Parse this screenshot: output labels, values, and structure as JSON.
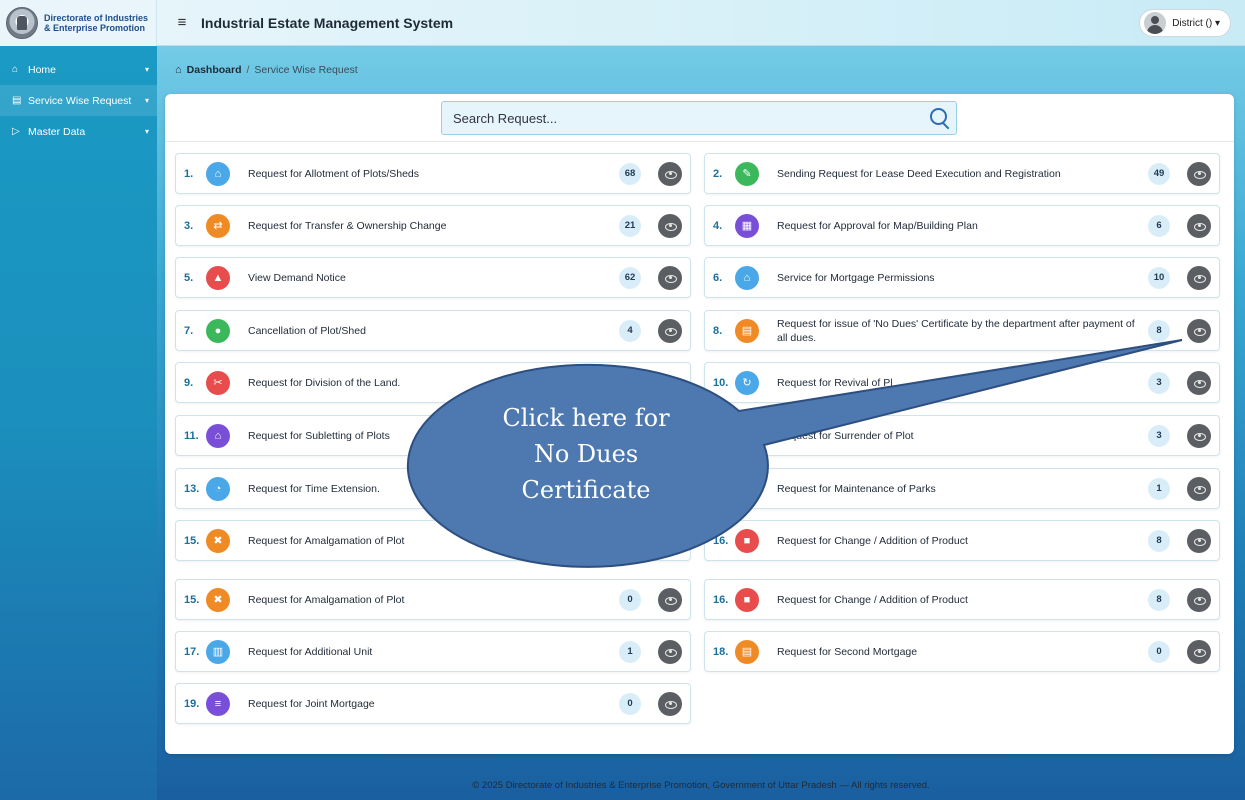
{
  "brand": {
    "line1": "Directorate of Industries",
    "line2": "& Enterprise Promotion"
  },
  "header": {
    "title": "Industrial Estate Management System",
    "user_label": "District () ▾"
  },
  "sidebar": {
    "items": [
      {
        "label": "Home",
        "icon": "home-icon"
      },
      {
        "label": "Service Wise Request",
        "icon": "document-icon"
      },
      {
        "label": "Master Data",
        "icon": "file-icon"
      }
    ]
  },
  "breadcrumb": {
    "root": "Dashboard",
    "separator": "/",
    "current": "Service Wise Request"
  },
  "search": {
    "placeholder": "Search Request..."
  },
  "services": [
    {
      "n": "1.",
      "label": "Request for Allotment of Plots/Sheds",
      "count": "68",
      "color": "#4aa8e8",
      "icon": "bank-icon",
      "glyph": "⌂"
    },
    {
      "n": "2.",
      "label": "Sending Request for Lease Deed Execution and Registration",
      "count": "49",
      "color": "#3cb85c",
      "icon": "edit-icon",
      "glyph": "✎"
    },
    {
      "n": "3.",
      "label": "Request for Transfer & Ownership Change",
      "count": "21",
      "color": "#f08a24",
      "icon": "transfer-icon",
      "glyph": "⇄"
    },
    {
      "n": "4.",
      "label": "Request for Approval for Map/Building Plan",
      "count": "6",
      "color": "#7a4fd8",
      "icon": "map-icon",
      "glyph": "▦"
    },
    {
      "n": "5.",
      "label": "View Demand Notice",
      "count": "62",
      "color": "#e84c4c",
      "icon": "bell-icon",
      "glyph": "▲"
    },
    {
      "n": "6.",
      "label": "Service for Mortgage Permissions",
      "count": "10",
      "color": "#4aa8e8",
      "icon": "bank-icon",
      "glyph": "⌂"
    },
    {
      "n": "7.",
      "label": "Cancellation of Plot/Shed",
      "count": "4",
      "color": "#3cb85c",
      "icon": "cancel-icon",
      "glyph": "●"
    },
    {
      "n": "8.",
      "label": "Request for issue of 'No Dues' Certificate by the department after payment of all dues.",
      "count": "8",
      "color": "#f08a24",
      "icon": "certificate-icon",
      "glyph": "▤"
    },
    {
      "n": "9.",
      "label": "Request for Division of the Land.",
      "count": "",
      "color": "#e84c4c",
      "icon": "scissors-icon",
      "glyph": "✂"
    },
    {
      "n": "10.",
      "label": "Request for Revival of Pl",
      "count": "3",
      "color": "#4aa8e8",
      "icon": "refresh-icon",
      "glyph": "↻"
    },
    {
      "n": "11.",
      "label": "Request for Subletting of Plots",
      "count": "",
      "color": "#7a4fd8",
      "icon": "home-icon",
      "glyph": "⌂"
    },
    {
      "n": "12.",
      "label": "Request for Surrender of Plot",
      "count": "3",
      "color": "#3cb85c",
      "icon": "flag-icon",
      "glyph": "⚑"
    },
    {
      "n": "13.",
      "label": "Request for Time Extension.",
      "count": "",
      "color": "#4aa8e8",
      "icon": "clock-icon",
      "glyph": "◔"
    },
    {
      "n": "14.",
      "label": "Request for Maintenance of Parks",
      "count": "1",
      "color": "#3cb85c",
      "icon": "tree-icon",
      "glyph": "♣"
    },
    {
      "n": "15.",
      "label": "Request for Amalgamation of Plot",
      "count": "",
      "color": "#f08a24",
      "icon": "merge-icon",
      "glyph": "✖"
    },
    {
      "n": "16.",
      "label": "Request for Change / Addition of Product",
      "count": "8",
      "color": "#e84c4c",
      "icon": "bookmark-icon",
      "glyph": "■"
    },
    {
      "n": "15.",
      "label": "Request for Amalgamation of Plot",
      "count": "0",
      "color": "#f08a24",
      "icon": "merge-icon",
      "glyph": "✖"
    },
    {
      "n": "16.",
      "label": "Request for Change / Addition of Product",
      "count": "8",
      "color": "#e84c4c",
      "icon": "bookmark-icon",
      "glyph": "■"
    },
    {
      "n": "17.",
      "label": "Request for Additional Unit",
      "count": "1",
      "color": "#4aa8e8",
      "icon": "factory-icon",
      "glyph": "▥"
    },
    {
      "n": "18.",
      "label": "Request for Second Mortgage",
      "count": "0",
      "color": "#f08a24",
      "icon": "document-icon",
      "glyph": "▤"
    },
    {
      "n": "19.",
      "label": "Request for Joint Mortgage",
      "count": "0",
      "color": "#7a4fd8",
      "icon": "handshake-icon",
      "glyph": "≡"
    }
  ],
  "callout": {
    "text_lines": [
      "Click here for",
      "No Dues",
      "Certificate"
    ],
    "fill": "#4d78b0",
    "stroke": "#2d4f80"
  },
  "footer": {
    "text": "© 2025 Directorate of Industries & Enterprise Promotion, Government of Uttar Pradesh — All rights reserved."
  }
}
